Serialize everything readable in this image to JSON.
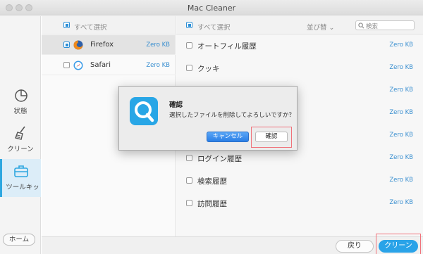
{
  "window": {
    "title": "Mac Cleaner"
  },
  "nav": {
    "items": [
      {
        "label": "状態",
        "icon": "pie-chart-icon"
      },
      {
        "label": "クリーン",
        "icon": "broom-icon"
      },
      {
        "label": "ツールキッ",
        "icon": "toolbox-icon"
      }
    ],
    "home_label": "ホーム"
  },
  "browsers": {
    "select_all": "すべて選択",
    "items": [
      {
        "name": "Firefox",
        "size": "Zero KB",
        "icon": "firefox-icon"
      },
      {
        "name": "Safari",
        "size": "Zero KB",
        "icon": "safari-icon"
      }
    ]
  },
  "history": {
    "select_all": "すべて選択",
    "sort_label": "並び替",
    "search_placeholder": "検索",
    "items": [
      {
        "label": "オートフィル履歴",
        "size": "Zero KB"
      },
      {
        "label": "クッキ",
        "size": "Zero KB"
      },
      {
        "label": "",
        "size": "Zero KB"
      },
      {
        "label": "",
        "size": "Zero KB"
      },
      {
        "label": "",
        "size": "Zero KB"
      },
      {
        "label": "ログイン履歴",
        "size": "Zero KB"
      },
      {
        "label": "検索履歴",
        "size": "Zero KB"
      },
      {
        "label": "訪問履歴",
        "size": "Zero KB"
      }
    ]
  },
  "footer": {
    "back_label": "戻り",
    "clean_label": "クリーン"
  },
  "dialog": {
    "title": "確認",
    "message": "選択したファイルを削除してよろしいですか？",
    "cancel_label": "キャンセル",
    "confirm_label": "確認"
  },
  "colors": {
    "accent": "#2aa3e8",
    "size_text": "#3a8fd0",
    "highlight": "#f0727a"
  }
}
